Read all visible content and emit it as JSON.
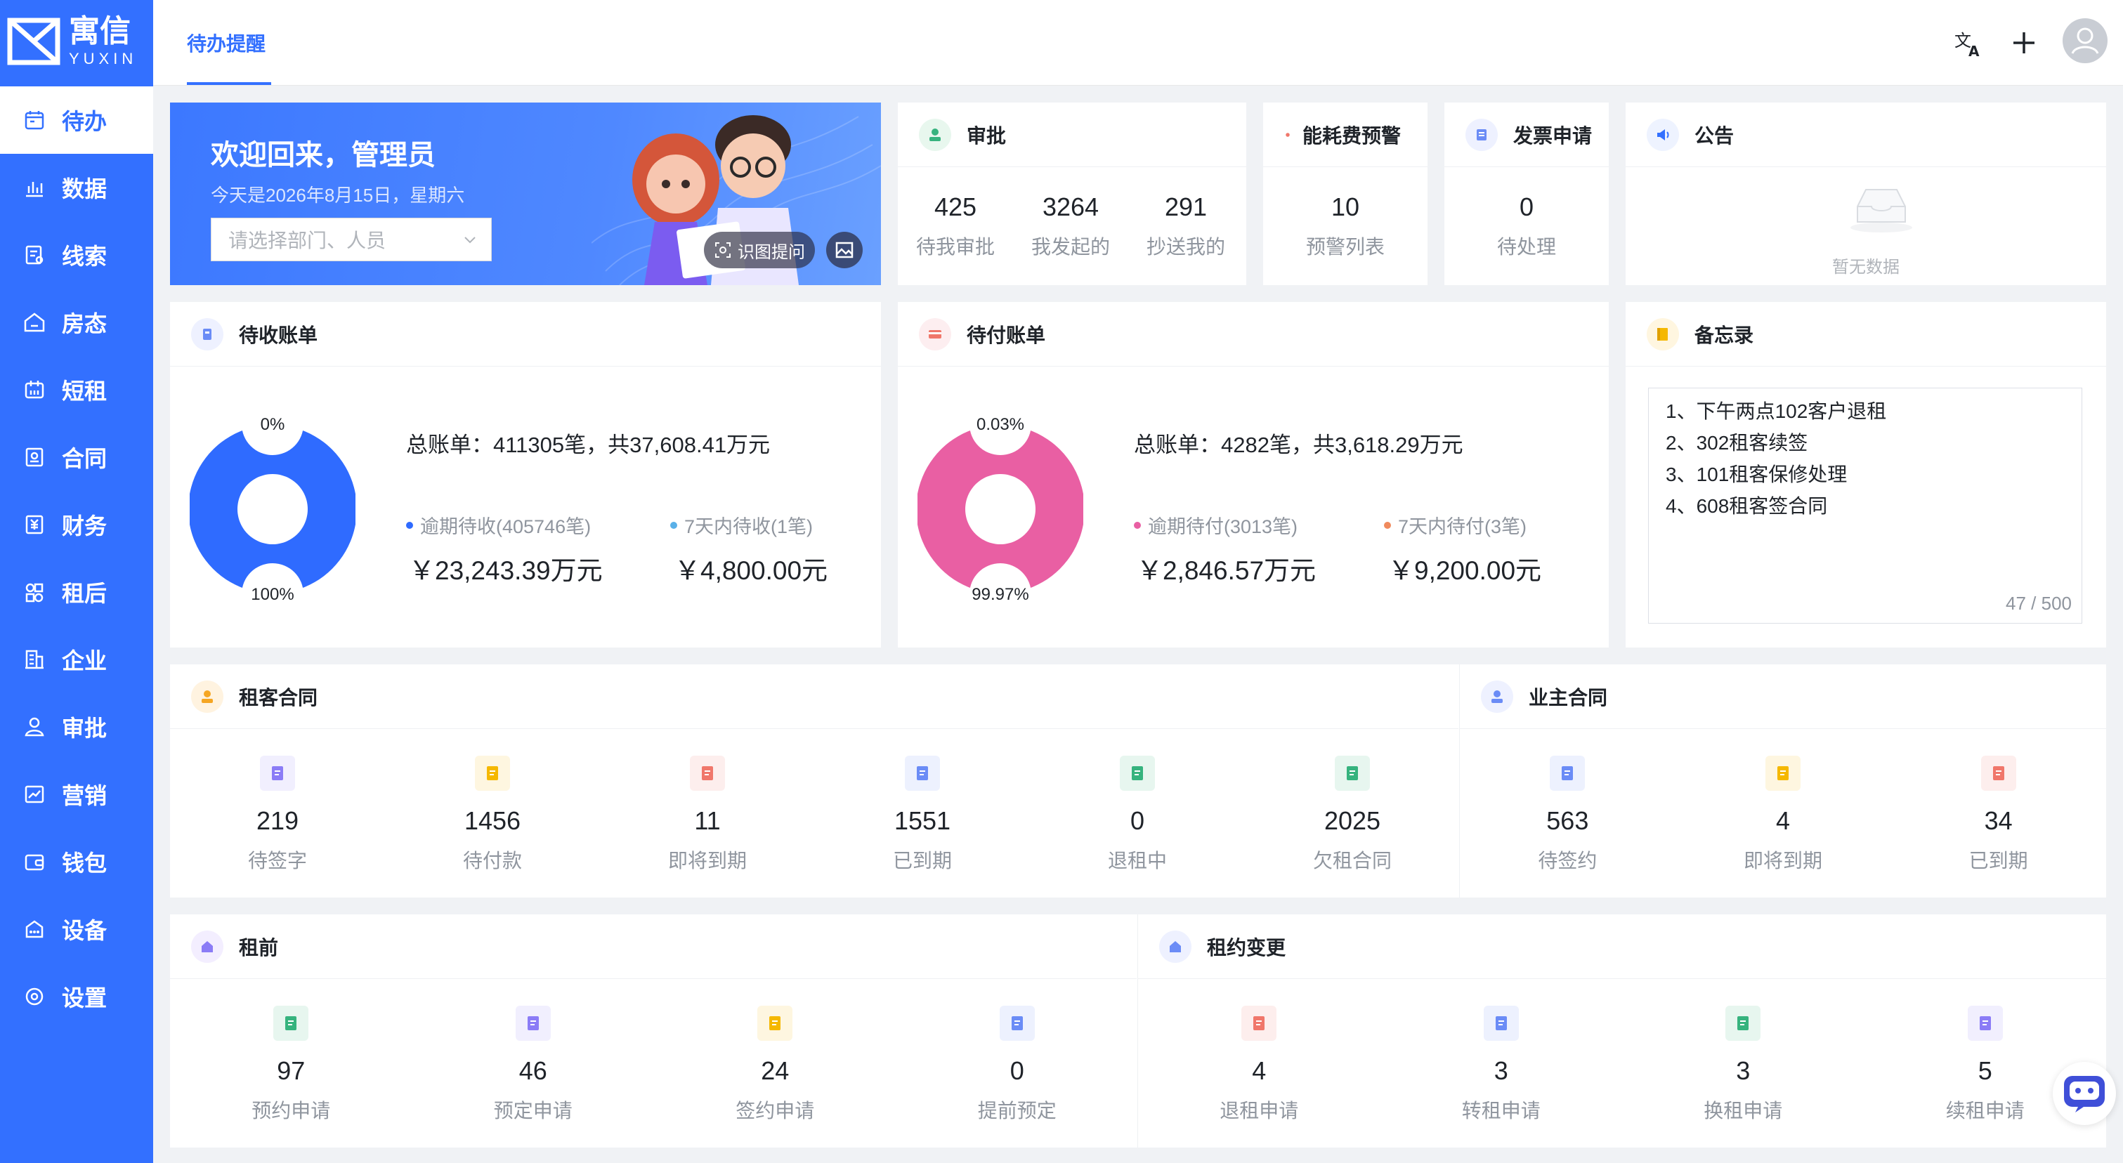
{
  "app": {
    "logo_cn": "寓信",
    "logo_en": "YUXIN",
    "active_tab": "待办提醒"
  },
  "sidebar": {
    "items": [
      {
        "label": "待办",
        "icon": "calendar-icon"
      },
      {
        "label": "数据",
        "icon": "bar-chart-icon"
      },
      {
        "label": "线索",
        "icon": "clue-icon"
      },
      {
        "label": "房态",
        "icon": "house-icon"
      },
      {
        "label": "短租",
        "icon": "short-rent-icon"
      },
      {
        "label": "合同",
        "icon": "contract-icon"
      },
      {
        "label": "财务",
        "icon": "finance-icon"
      },
      {
        "label": "租后",
        "icon": "after-rent-icon"
      },
      {
        "label": "企业",
        "icon": "building-icon"
      },
      {
        "label": "审批",
        "icon": "user-approve-icon"
      },
      {
        "label": "营销",
        "icon": "marketing-icon"
      },
      {
        "label": "钱包",
        "icon": "wallet-icon"
      },
      {
        "label": "设备",
        "icon": "device-icon"
      },
      {
        "label": "设置",
        "icon": "settings-icon"
      }
    ]
  },
  "welcome": {
    "title": "欢迎回来，管理员",
    "date": "今天是2026年8月15日，星期六",
    "select_placeholder": "请选择部门、人员",
    "ocr_button": "识图提问"
  },
  "approval": {
    "title": "审批",
    "stats": [
      {
        "value": "425",
        "label": "待我审批"
      },
      {
        "value": "3264",
        "label": "我发起的"
      },
      {
        "value": "291",
        "label": "抄送我的"
      }
    ]
  },
  "energy": {
    "title": "能耗费预警",
    "value": "10",
    "label": "预警列表"
  },
  "invoice": {
    "title": "发票申请",
    "value": "0",
    "label": "待处理"
  },
  "notice": {
    "title": "公告",
    "empty": "暂无数据"
  },
  "receivable": {
    "title": "待收账单",
    "total": "总账单：411305笔，共37,608.41万元",
    "pct_top": "0%",
    "pct_bottom": "100%",
    "overdue_label": "逾期待收(405746笔)",
    "overdue_amount": "￥23,243.39万元",
    "soon_label": "7天内待收(1笔)",
    "soon_amount": "￥4,800.00元",
    "color_main": "#2f6bff",
    "color_dot2": "#5ab0e8",
    "ratio": [
      0.0,
      1.0
    ]
  },
  "payable": {
    "title": "待付账单",
    "total": "总账单：4282笔，共3,618.29万元",
    "pct_top": "0.03%",
    "pct_bottom": "99.97%",
    "overdue_label": "逾期待付(3013笔)",
    "overdue_amount": "￥2,846.57万元",
    "soon_label": "7天内待付(3笔)",
    "soon_amount": "￥9,200.00元",
    "color_main": "#e95fa3",
    "color_dot2": "#f08a5d",
    "ratio": [
      0.0003,
      0.9997
    ]
  },
  "memo": {
    "title": "备忘录",
    "lines": [
      "1、下午两点102客户退租",
      "2、302租客续签",
      "3、101租客保修处理",
      "4、608租客签合同"
    ],
    "count": "47 / 500"
  },
  "tenant_contract": {
    "title": "租客合同",
    "items": [
      {
        "value": "219",
        "label": "待签字",
        "color": "#8b7cf6"
      },
      {
        "value": "1456",
        "label": "待付款",
        "color": "#f5b800"
      },
      {
        "value": "11",
        "label": "即将到期",
        "color": "#f0776b"
      },
      {
        "value": "1551",
        "label": "已到期",
        "color": "#6b8cf6"
      },
      {
        "value": "0",
        "label": "退租中",
        "color": "#36b37e"
      },
      {
        "value": "2025",
        "label": "欠租合同",
        "color": "#36b37e"
      }
    ]
  },
  "owner_contract": {
    "title": "业主合同",
    "items": [
      {
        "value": "563",
        "label": "待签约",
        "color": "#6b8cf6"
      },
      {
        "value": "4",
        "label": "即将到期",
        "color": "#f5b800"
      },
      {
        "value": "34",
        "label": "已到期",
        "color": "#f0776b"
      }
    ]
  },
  "pre_rent": {
    "title": "租前",
    "items": [
      {
        "value": "97",
        "label": "预约申请",
        "color": "#36b37e"
      },
      {
        "value": "46",
        "label": "预定申请",
        "color": "#8b7cf6"
      },
      {
        "value": "24",
        "label": "签约申请",
        "color": "#f5b800"
      },
      {
        "value": "0",
        "label": "提前预定",
        "color": "#6b8cf6"
      }
    ]
  },
  "lease_change": {
    "title": "租约变更",
    "items": [
      {
        "value": "4",
        "label": "退租申请",
        "color": "#f0776b"
      },
      {
        "value": "3",
        "label": "转租申请",
        "color": "#6b8cf6"
      },
      {
        "value": "3",
        "label": "换租申请",
        "color": "#36b37e"
      },
      {
        "value": "5",
        "label": "续租申请",
        "color": "#8b7cf6"
      }
    ]
  }
}
